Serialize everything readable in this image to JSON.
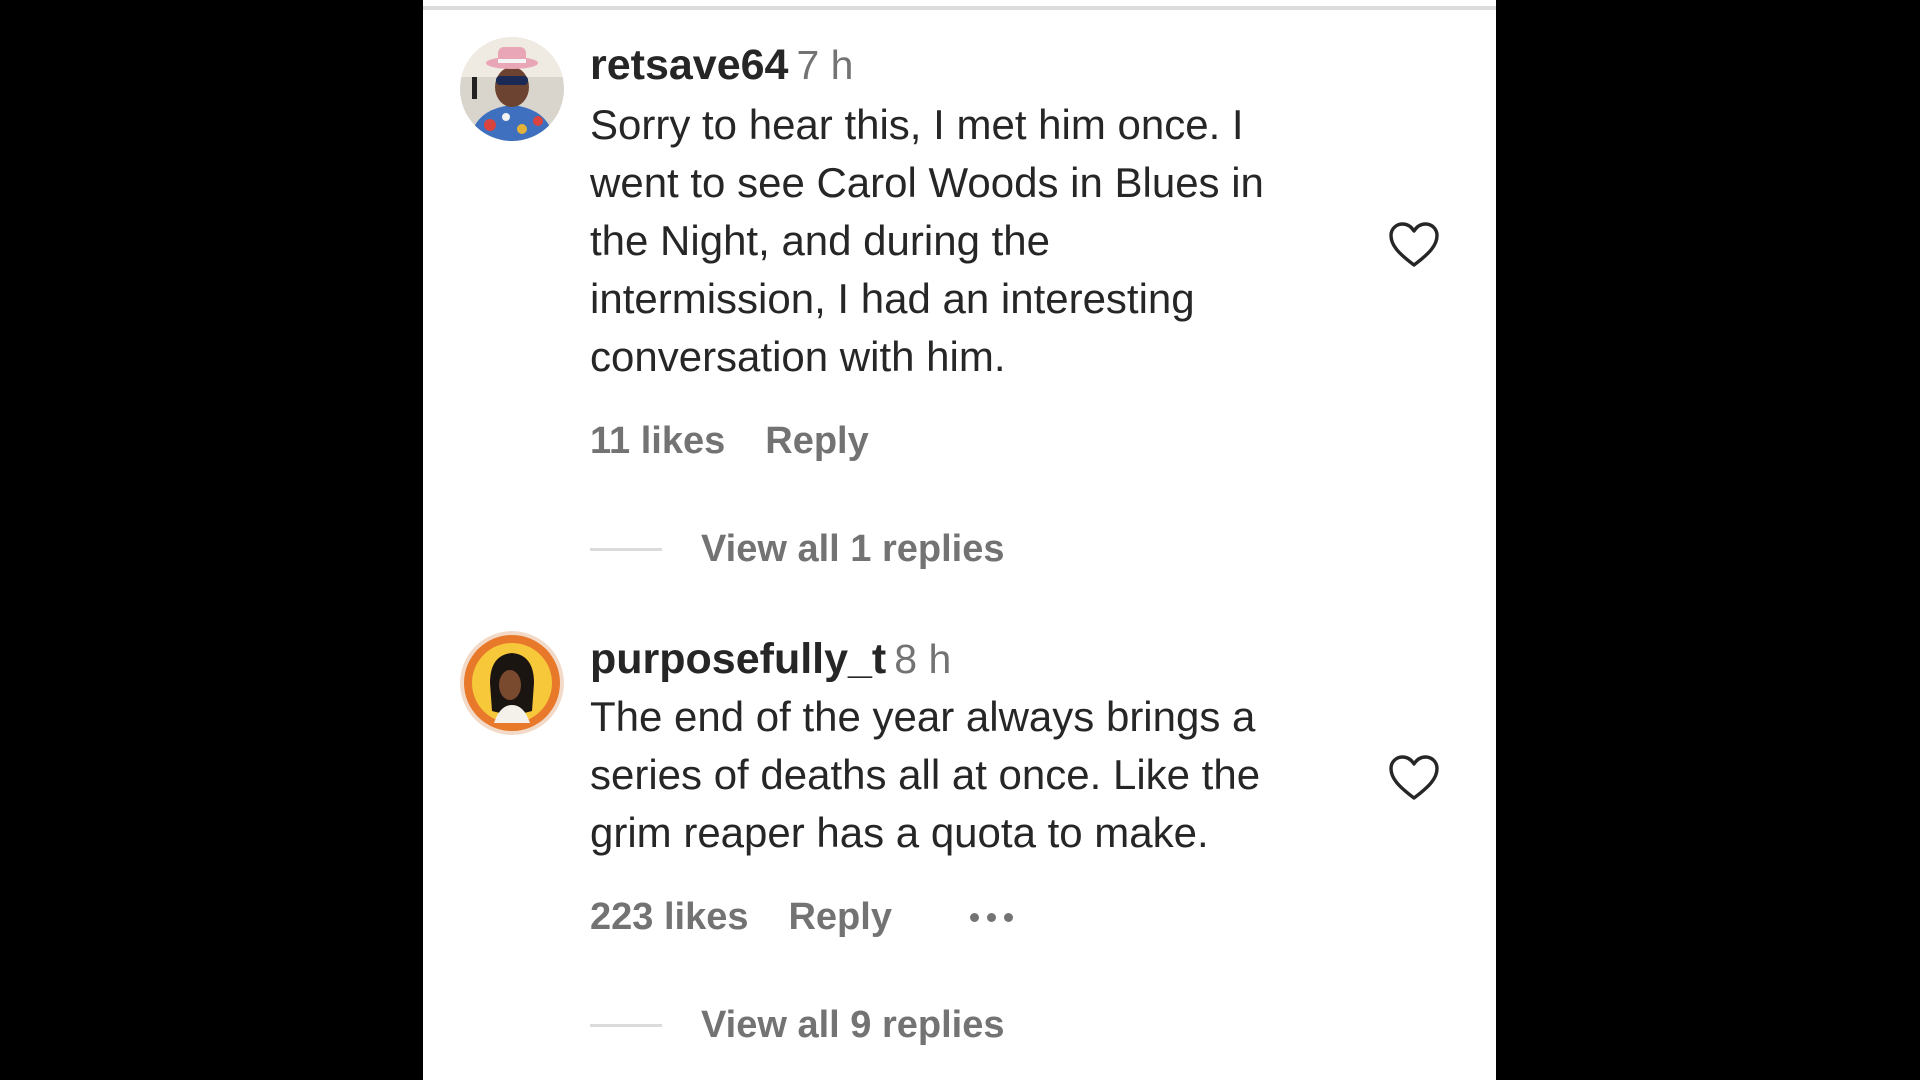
{
  "comments": [
    {
      "username": "retsave64",
      "time": "7 h",
      "text": "Sorry to hear this, I met him once. I\nwent to see Carol Woods in Blues in\nthe Night, and during the\nintermission, I had an interesting\nconversation with him.",
      "likes": "11 likes",
      "reply": "Reply",
      "view_replies": "View all 1 replies",
      "avatar_icon": "user-avatar"
    },
    {
      "username": "purposefully_t",
      "time": "8 h",
      "text": "The end of the year always brings a\nseries of deaths all at once. Like the\ngrim reaper has a quota to make.",
      "likes": "223 likes",
      "reply": "Reply",
      "more_icon": "more-options-icon",
      "view_replies": "View all 9 replies",
      "avatar_icon": "user-avatar"
    }
  ],
  "colors": {
    "primary_text": "#262626",
    "secondary_text": "#737373",
    "divider": "#dbdbdb",
    "avatar_ring": "#e8792b"
  }
}
